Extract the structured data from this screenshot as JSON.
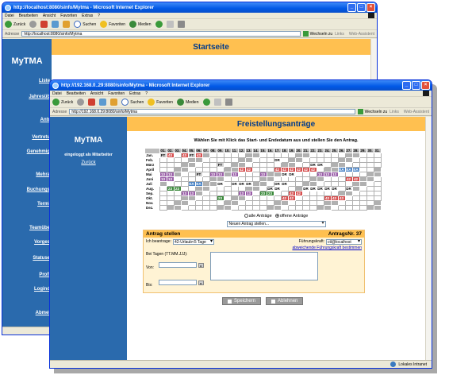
{
  "back_window": {
    "title": "http://localhost:8080/sinfo/Mytma - Microsoft Internet Explorer",
    "menu": [
      "Datei",
      "Bearbeiten",
      "Ansicht",
      "Favoriten",
      "Extras",
      "?"
    ],
    "toolbar": {
      "back": "Zurück",
      "search": "Suchen",
      "favorites": "Favoriten",
      "media": "Medien"
    },
    "address_label": "Adresse",
    "address_value": "http://localhost:8080/sinfo/Mytma",
    "go_label": "Wechseln zu",
    "links_label": "Links",
    "assistant_label": "Web-Assistent",
    "brand": "MyTMA",
    "page_title": "Startseite",
    "nav": [
      "Liste",
      "Jahresüb",
      "Antr",
      "Vertretu",
      "Genehmig",
      "Mehra",
      "Buchungs",
      "Termi",
      "Teamübe",
      "Vorges",
      "Statuse",
      "Profi",
      "Logind",
      "Abmel"
    ]
  },
  "front_window": {
    "title": "http://192.168.0..29:8080/sinfo/Mytma - Microsoft Internet Explorer",
    "menu": [
      "Datei",
      "Bearbeiten",
      "Ansicht",
      "Favoriten",
      "Extras",
      "?"
    ],
    "toolbar": {
      "back": "Zurück",
      "search": "Suchen",
      "favorites": "Favoriten",
      "media": "Medien"
    },
    "address_label": "Adresse",
    "address_value": "http://192.168.0.29:8080/sinfo/Mytma",
    "go_label": "Wechseln zu",
    "links_label": "Links",
    "assistant_label": "Web-Assistent",
    "brand": "MyTMA",
    "login_info": "eingeloggt als Mitarbeiter",
    "back_link": "Zurück",
    "page_title": "Freistellungsanträge",
    "instruction": "Wählen Sie mit Klick das Start- und Endedatum aus und stellen Sie den Antrag.",
    "status_zone": "Lokales Intranet"
  },
  "calendar": {
    "days": [
      "01.",
      "02.",
      "03.",
      "04.",
      "05.",
      "06.",
      "07.",
      "08.",
      "09.",
      "10.",
      "11.",
      "12.",
      "13.",
      "14.",
      "15.",
      "16.",
      "17.",
      "18.",
      "19.",
      "20.",
      "21.",
      "22.",
      "23.",
      "24.",
      "25.",
      "26.",
      "27.",
      "28.",
      "29.",
      "30.",
      "31."
    ],
    "months": [
      {
        "name": "Jan.",
        "cells": [
          "FT",
          "43",
          "",
          "43",
          "FT",
          "43",
          "",
          "",
          "",
          "",
          "",
          "",
          "",
          "",
          "",
          "",
          "",
          "",
          "",
          "",
          "",
          "",
          "",
          "",
          "",
          "",
          "",
          "",
          "",
          "",
          ""
        ]
      },
      {
        "name": "Feb.",
        "cells": [
          "",
          "",
          "",
          "",
          "",
          "",
          "",
          "",
          "",
          "",
          "",
          "",
          "",
          "",
          "",
          "",
          "DR",
          "",
          "",
          "",
          "",
          "",
          "",
          "",
          "",
          "",
          "",
          "",
          "",
          "",
          ""
        ]
      },
      {
        "name": "März",
        "cells": [
          "",
          "",
          "",
          "",
          "",
          "",
          "",
          "",
          "FT",
          "",
          "",
          "",
          "",
          "",
          "",
          "",
          "",
          "",
          "",
          "",
          "",
          "DR",
          "DR",
          "",
          "",
          "",
          "",
          "",
          "",
          "",
          ""
        ]
      },
      {
        "name": "April",
        "cells": [
          "",
          "",
          "",
          "",
          "",
          "",
          "",
          "",
          "",
          "",
          "",
          "42",
          "42",
          "",
          "",
          "",
          "42",
          "42",
          "42",
          "42",
          "42",
          "42",
          "",
          "",
          "",
          "EA",
          "EA",
          "EA",
          "",
          "",
          ""
        ]
      },
      {
        "name": "Mai",
        "cells": [
          "13",
          "13",
          "",
          "",
          "",
          "FT",
          "",
          "13",
          "13",
          "",
          "13",
          "",
          "",
          "",
          "13",
          "",
          "",
          "DR",
          "DR",
          "",
          "",
          "",
          "13",
          "13",
          "13",
          "",
          "",
          "",
          "",
          "",
          ""
        ]
      },
      {
        "name": "Juni",
        "cells": [
          "13",
          "13",
          "",
          "",
          "",
          "",
          "",
          "",
          "",
          "",
          "",
          "",
          "",
          "",
          "",
          "",
          "",
          "",
          "",
          "",
          "",
          "",
          "",
          "",
          "",
          "",
          "42",
          "42",
          "",
          "",
          ""
        ]
      },
      {
        "name": "Juli",
        "cells": [
          "",
          "",
          "",
          "",
          "EA",
          "EA",
          "",
          "",
          "DR",
          "",
          "DR",
          "DR",
          "DR",
          "",
          "",
          "",
          "DR",
          "DR",
          "",
          "",
          "",
          "",
          "",
          "",
          "",
          "",
          "",
          "",
          "",
          "",
          ""
        ]
      },
      {
        "name": "Aug.",
        "cells": [
          "",
          "23",
          "23",
          "",
          "",
          "",
          "",
          "",
          "",
          "",
          "",
          "",
          "",
          "",
          "",
          "DR",
          "DR",
          "",
          "",
          "",
          "DR",
          "DR",
          "DR",
          "DR",
          "DR",
          "",
          "DR",
          "",
          "",
          "",
          ""
        ]
      },
      {
        "name": "Sep.",
        "cells": [
          "",
          "",
          "",
          "13",
          "13",
          "",
          "",
          "",
          "",
          "",
          "",
          "13",
          "13",
          "",
          "23",
          "23",
          "",
          "",
          "42",
          "42",
          "",
          "",
          "",
          "",
          "",
          "",
          "",
          "",
          "",
          "",
          ""
        ]
      },
      {
        "name": "Okt.",
        "cells": [
          "",
          "",
          "",
          "",
          "",
          "",
          "",
          "",
          "23",
          "",
          "",
          "",
          "",
          "",
          "",
          "",
          "",
          "42",
          "42",
          "",
          "",
          "",
          "",
          "43",
          "43",
          "43",
          "",
          "",
          "",
          "",
          ""
        ]
      },
      {
        "name": "Nov.",
        "cells": [
          "",
          "",
          "",
          "",
          "",
          "",
          "",
          "",
          "",
          "",
          "",
          "",
          "",
          "",
          "",
          "",
          "",
          "",
          "",
          "",
          "",
          "",
          "",
          "",
          "",
          "",
          "",
          "",
          "",
          "",
          ""
        ]
      },
      {
        "name": "Dez.",
        "cells": [
          "",
          "",
          "",
          "",
          "",
          "",
          "",
          "",
          "",
          "",
          "",
          "",
          "",
          "",
          "",
          "",
          "",
          "",
          "",
          "",
          "",
          "",
          "",
          "",
          "",
          "",
          "",
          "",
          "",
          "",
          ""
        ]
      }
    ],
    "colors": {
      "42": "#d65050",
      "43": "#d65050",
      "13": "#9a5fa8",
      "23": "#3b8a3b",
      "EA": "#4e86c6",
      "DR": "#3b8a3b",
      "FT": "#d4d4d4"
    }
  },
  "filter": {
    "all_label": "alle Anträge",
    "open_label": "offene Anträge",
    "selected": "open"
  },
  "request_select": {
    "value": "Neuen Antrag stellen..."
  },
  "form": {
    "heading": "Antrag stellen",
    "number": "AntragsNr. 37",
    "request_label": "Ich beantrage:",
    "request_value": "42-Urlaub<5 Tage",
    "manager_label": "Führungskraft:",
    "manager_value": "ctl@localhost",
    "manager_link": "abweichende Führungskraft bestimmen",
    "days_label": "Bei Tagen (TT.MM.JJJ):",
    "from_label": "Von:",
    "to_label": "Bis:"
  },
  "buttons": {
    "save": "Speichern",
    "reject": "Ablehnen"
  }
}
